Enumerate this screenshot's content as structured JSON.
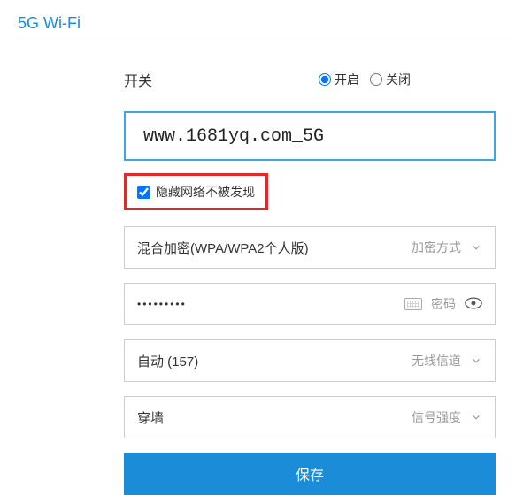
{
  "section_title": "5G Wi-Fi",
  "switch": {
    "label": "开关",
    "on_label": "开启",
    "off_label": "关闭",
    "selected": "on"
  },
  "ssid": "www.1681yq.com_5G",
  "hide_network": {
    "label": "隐藏网络不被发现",
    "checked": true
  },
  "encryption": {
    "value": "混合加密(WPA/WPA2个人版)",
    "caption": "加密方式"
  },
  "password": {
    "value": "•••••••••",
    "caption": "密码"
  },
  "channel": {
    "value": "自动 (157)",
    "caption": "无线信道"
  },
  "signal": {
    "value": "穿墙",
    "caption": "信号强度"
  },
  "save_label": "保存"
}
